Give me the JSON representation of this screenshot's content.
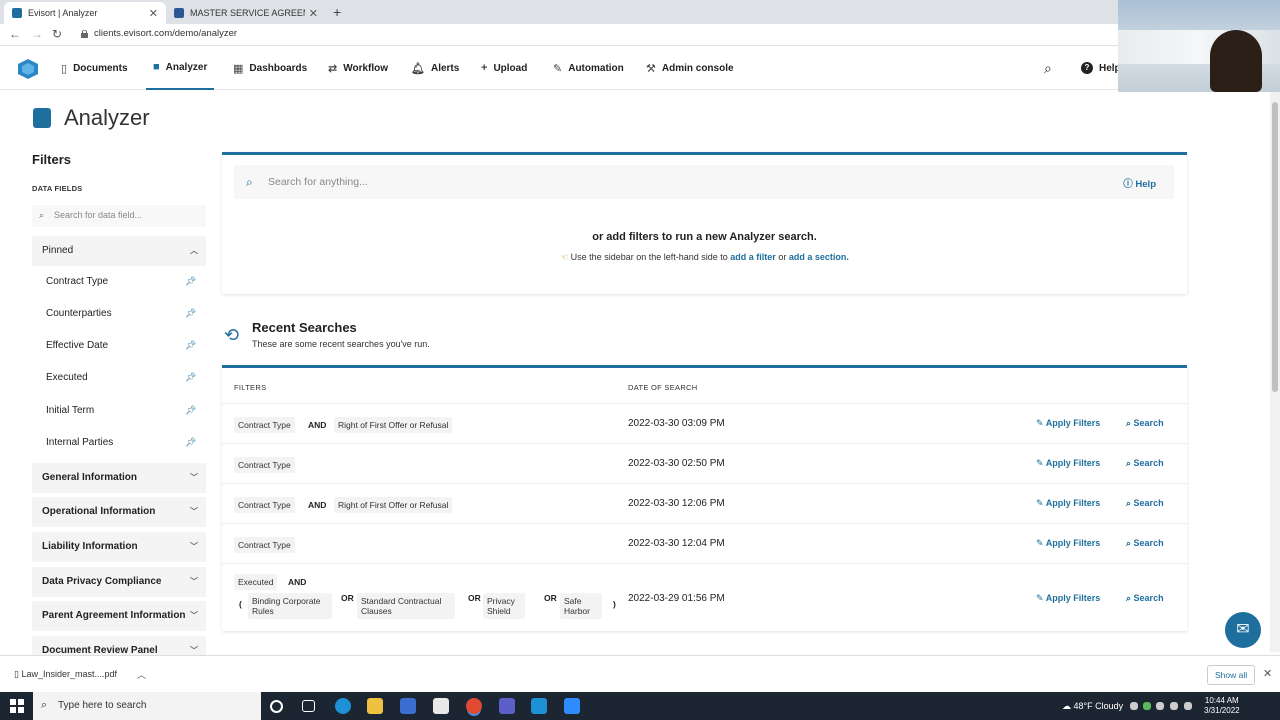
{
  "browser": {
    "tabs": [
      {
        "label": "Evisort | Analyzer",
        "active": true
      },
      {
        "label": "MASTER SERVICE AGREEMENT | ...",
        "active": false
      }
    ],
    "new_tab": "+",
    "url": "clients.evisort.com/demo/analyzer"
  },
  "nav": {
    "items": [
      {
        "label": "Documents",
        "icon": "document-icon"
      },
      {
        "label": "Analyzer",
        "icon": "analyzer-icon",
        "active": true
      },
      {
        "label": "Dashboards",
        "icon": "dashboard-icon"
      },
      {
        "label": "Workflow",
        "icon": "workflow-icon"
      },
      {
        "label": "Alerts",
        "icon": "bell-icon"
      },
      {
        "label": "Upload",
        "icon": "plus-icon"
      },
      {
        "label": "Automation",
        "icon": "wand-icon"
      },
      {
        "label": "Admin console",
        "icon": "wrench-icon"
      }
    ],
    "help": "Help"
  },
  "page": {
    "title": "Analyzer"
  },
  "filters": {
    "heading": "Filters",
    "data_fields_label": "DATA FIELDS",
    "search_placeholder": "Search for data field...",
    "pinned_label": "Pinned",
    "pinned": [
      "Contract Type",
      "Counterparties",
      "Effective Date",
      "Executed",
      "Initial Term",
      "Internal Parties"
    ],
    "sections": [
      "General Information",
      "Operational Information",
      "Liability Information",
      "Data Privacy Compliance",
      "Parent Agreement Information",
      "Document Review Panel"
    ]
  },
  "search": {
    "placeholder": "Search for anything...",
    "help": "Help",
    "or_text": "or add filters to run a new Analyzer search.",
    "use_text": "Use the sidebar on the left-hand side to",
    "add_filter": "add a filter",
    "or": "or",
    "add_section": "add a section."
  },
  "recent": {
    "title": "Recent Searches",
    "subtitle": "These are some recent searches you've run.",
    "col_filters": "FILTERS",
    "col_date": "DATE OF SEARCH",
    "apply_label": "Apply Filters",
    "search_label": "Search",
    "rows": [
      {
        "chips": [
          "Contract Type",
          "AND",
          "Right of First Offer or Refusal"
        ],
        "date": "2022-03-30 03:09 PM"
      },
      {
        "chips": [
          "Contract Type"
        ],
        "date": "2022-03-30 02:50 PM"
      },
      {
        "chips": [
          "Contract Type",
          "AND",
          "Right of First Offer or Refusal"
        ],
        "date": "2022-03-30 12:06 PM"
      },
      {
        "chips": [
          "Contract Type"
        ],
        "date": "2022-03-30 12:04 PM"
      },
      {
        "chips": [
          "Executed",
          "AND",
          "Binding Corporate Rules",
          "OR",
          "Standard Contractual Clauses",
          "OR",
          "Privacy Shield",
          "OR",
          "Safe Harbor"
        ],
        "date": "2022-03-29 01:56 PM"
      }
    ]
  },
  "downloads": {
    "file": "Law_Insider_mast....pdf",
    "show_all": "Show all"
  },
  "taskbar": {
    "search_placeholder": "Type here to search",
    "weather": "48°F  Cloudy",
    "time": "10:44 AM",
    "date": "3/31/2022"
  },
  "colors": {
    "accent": "#1f6f9e"
  }
}
